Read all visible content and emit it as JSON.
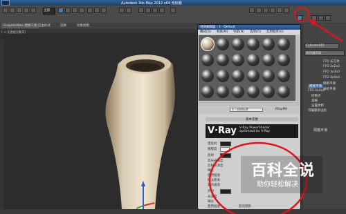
{
  "app": {
    "title": "Autodesk 3ds Max 2012 x64  无标题",
    "viewport_label": "[ + ][透视][真实]",
    "select_set": "全部"
  },
  "ribbon": {
    "tabs": [
      "GraphiteMax 建模工具",
      "自由形式",
      "选择",
      "对象绘制"
    ]
  },
  "material_editor": {
    "title": "材质编辑器 - 1 - Default",
    "menu": [
      "模式(D)",
      "材质(M)",
      "导航(N)",
      "选项(O)",
      "实用程序(U)"
    ],
    "material_name": "1 - Default",
    "material_type": "VRayMtl",
    "basic_params_header": "基本参数",
    "vray_banner_line1": "V-Ray PowerShader",
    "vray_banner_line2": "optimized for V-Ray",
    "params": [
      "漫反射",
      "粗糙度",
      "反射",
      "高光光泽度",
      "反射光泽度",
      "细分",
      "使用插值",
      "暗淡距离",
      "影响通道",
      "折射",
      "光泽度",
      "细分",
      "使用插值",
      "影响阴影"
    ],
    "slot_colors": [
      "#c8b59a",
      "#3d3d3d"
    ]
  },
  "command_panel": {
    "object_name": "Cylinder001",
    "modifier_list": "修改器列表",
    "buttons": [
      "FFD 长方体",
      "FFD 2x2x2",
      "FFD 3x3x3",
      "FFD 4x4x4",
      "网格平滑",
      "涡轮平滑"
    ],
    "stack": [
      "网格平滑",
      "FFD 4x4x4",
      "控制点",
      "晶格",
      "设置体积",
      "可编辑多边形"
    ],
    "rollout_title": "网格平滑"
  },
  "annotation": {
    "banner_title": "百科全说",
    "banner_subtitle": "助你轻松解决",
    "highlight_color": "#e0141b"
  }
}
